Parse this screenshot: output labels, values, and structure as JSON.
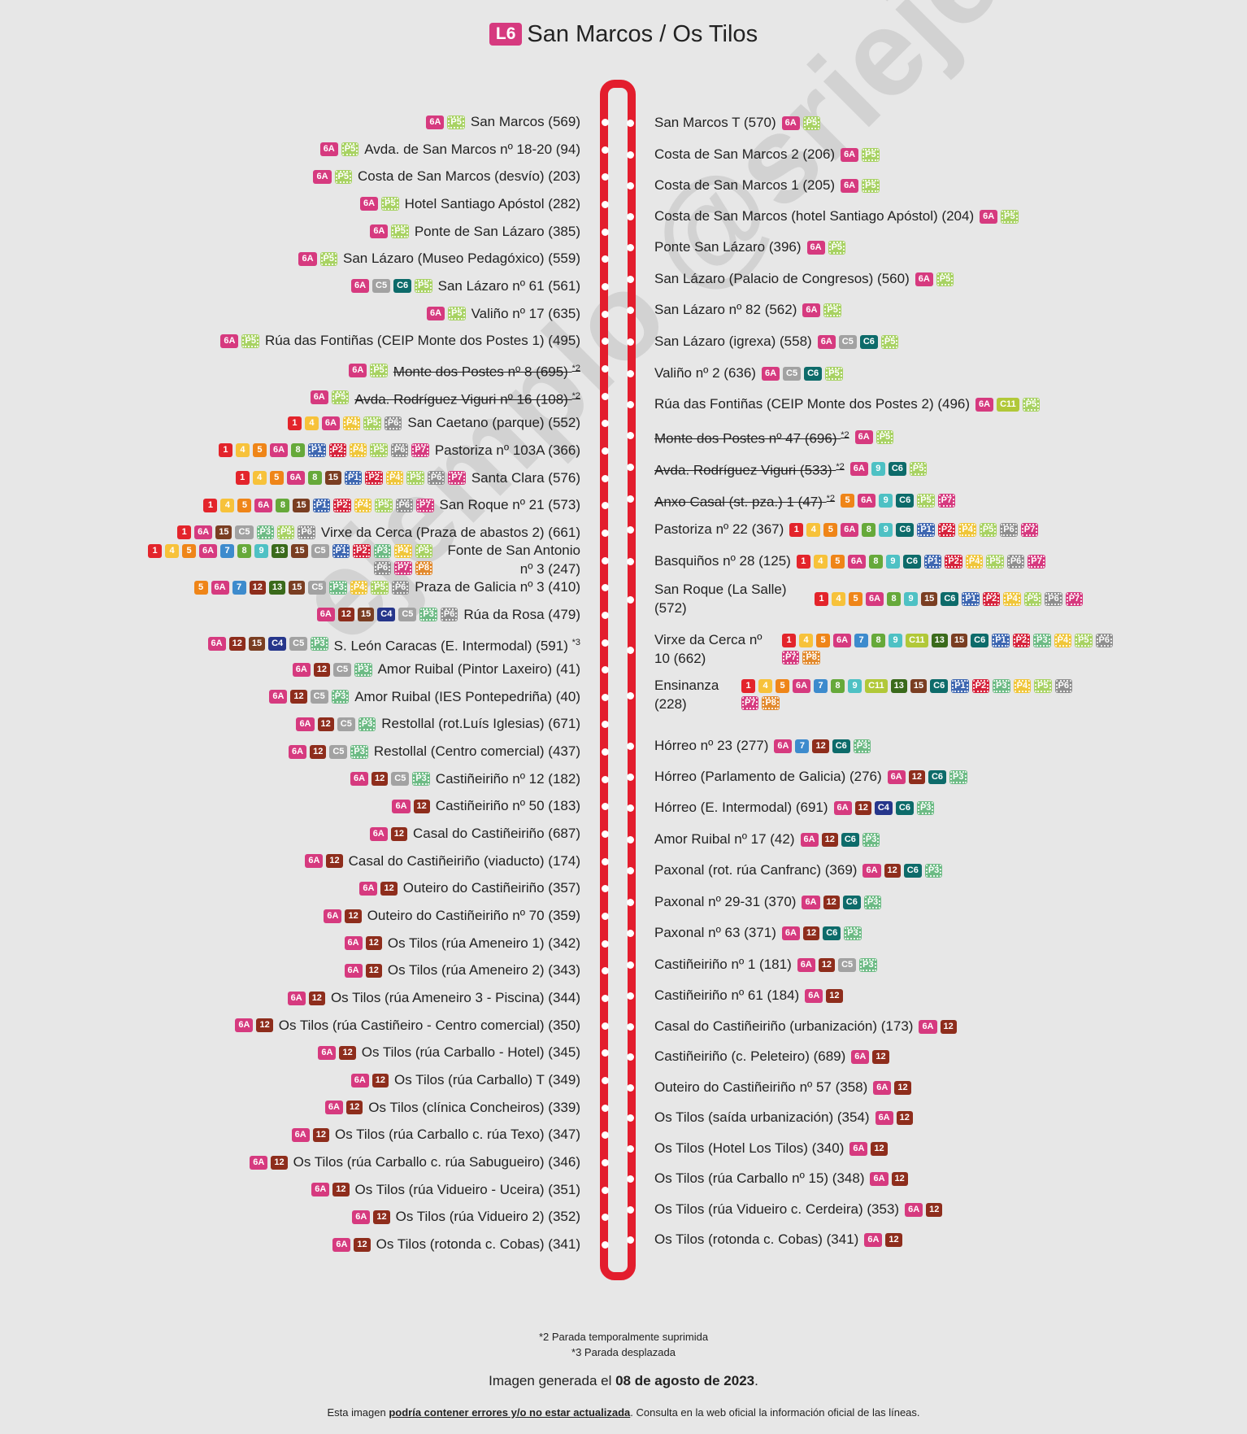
{
  "title": {
    "line": "L6",
    "name": "San Marcos / Os Tilos"
  },
  "colors": {
    "rail": "#e31d2d",
    "1": "#e3242b",
    "4": "#f7c23a",
    "5": "#ef8518",
    "6A": "#d63a7f",
    "7": "#3d8bcd",
    "8": "#66a93a",
    "9": "#4ec1c4",
    "12": "#8e2d1c",
    "13": "#3a6a1b",
    "15": "#7a3e22",
    "C4": "#26368b",
    "C5": "#a2a2a2",
    "C6": "#0d6b6a",
    "C11": "#b1c838",
    "P1": "#3e67b1",
    "P2": "#d6233c",
    "P3": "#6dbb85",
    "P4": "#f0c63a",
    "P5": "#a8d263",
    "P6": "#8f8f8f",
    "P7": "#d63a7f",
    "P8": "#e28a2e"
  },
  "left_stops": [
    {
      "name": "San Marcos (569)",
      "lines": [
        "6A",
        "P5"
      ]
    },
    {
      "name": "Avda. de San Marcos nº 18-20 (94)",
      "lines": [
        "6A",
        "P5"
      ]
    },
    {
      "name": "Costa de San Marcos (desvío) (203)",
      "lines": [
        "6A",
        "P5"
      ]
    },
    {
      "name": "Hotel Santiago Apóstol (282)",
      "lines": [
        "6A",
        "P5"
      ]
    },
    {
      "name": "Ponte de San Lázaro (385)",
      "lines": [
        "6A",
        "P5"
      ]
    },
    {
      "name": "San Lázaro (Museo Pedagóxico) (559)",
      "lines": [
        "6A",
        "P5"
      ]
    },
    {
      "name": "San Lázaro nº 61 (561)",
      "lines": [
        "6A",
        "C5",
        "C6",
        "P5"
      ]
    },
    {
      "name": "Valiño nº 17 (635)",
      "lines": [
        "6A",
        "P5"
      ]
    },
    {
      "name": "Rúa das Fontiñas (CEIP Monte dos Postes 1) (495)",
      "lines": [
        "6A",
        "P5"
      ]
    },
    {
      "name": "Monte dos Postes nº 8 (695)",
      "note": "*2",
      "strike": true,
      "lines": [
        "6A",
        "P5"
      ]
    },
    {
      "name": "Avda. Rodríguez Viguri nº 16 (108)",
      "note": "*2",
      "strike": true,
      "lines": [
        "6A",
        "P5"
      ]
    },
    {
      "name": "San Caetano (parque) (552)",
      "lines": [
        "1",
        "4",
        "6A",
        "P4",
        "P5",
        "P6"
      ]
    },
    {
      "name": "Pastoriza nº 103A (366)",
      "lines": [
        "1",
        "4",
        "5",
        "6A",
        "8",
        "P1",
        "P2",
        "P4",
        "P5",
        "P6",
        "P7"
      ]
    },
    {
      "name": "Santa Clara (576)",
      "lines": [
        "1",
        "4",
        "5",
        "6A",
        "8",
        "15",
        "P1",
        "P2",
        "P4",
        "P5",
        "P6",
        "P7"
      ]
    },
    {
      "name": "San Roque nº 21 (573)",
      "lines": [
        "1",
        "4",
        "5",
        "6A",
        "8",
        "15",
        "P1",
        "P2",
        "P4",
        "P5",
        "P6",
        "P7"
      ]
    },
    {
      "name": "Virxe da Cerca (Praza de abastos 2) (661)",
      "lines": [
        "1",
        "6A",
        "15",
        "C5",
        "P3",
        "P5",
        "P6"
      ]
    },
    {
      "name": "Fonte de San Antonio nº 3 (247)",
      "lines": [
        "1",
        "4",
        "5",
        "6A",
        "7",
        "8",
        "9",
        "13",
        "15",
        "C5",
        "P1",
        "P2",
        "P3",
        "P4",
        "P5",
        "P6",
        "P7",
        "P8"
      ],
      "wrap": true
    },
    {
      "name": "Praza de Galicia nº 3 (410)",
      "lines": [
        "5",
        "6A",
        "7",
        "12",
        "13",
        "15",
        "C5",
        "P3",
        "P4",
        "P5",
        "P6"
      ]
    },
    {
      "name": "Rúa da Rosa (479)",
      "lines": [
        "6A",
        "12",
        "15",
        "C4",
        "C5",
        "P3",
        "P6"
      ]
    },
    {
      "name": "S. León Caracas (E. Intermodal) (591)",
      "note": "*3",
      "lines": [
        "6A",
        "12",
        "15",
        "C4",
        "C5",
        "P3"
      ]
    },
    {
      "name": "Amor Ruibal (Pintor Laxeiro) (41)",
      "lines": [
        "6A",
        "12",
        "C5",
        "P3"
      ]
    },
    {
      "name": "Amor Ruibal (IES Pontepedriña) (40)",
      "lines": [
        "6A",
        "12",
        "C5",
        "P3"
      ]
    },
    {
      "name": "Restollal (rot.Luís Iglesias) (671)",
      "lines": [
        "6A",
        "12",
        "C5",
        "P3"
      ]
    },
    {
      "name": "Restollal (Centro comercial) (437)",
      "lines": [
        "6A",
        "12",
        "C5",
        "P3"
      ]
    },
    {
      "name": "Castiñeiriño nº 12 (182)",
      "lines": [
        "6A",
        "12",
        "C5",
        "P3"
      ]
    },
    {
      "name": "Castiñeiriño nº 50 (183)",
      "lines": [
        "6A",
        "12"
      ]
    },
    {
      "name": "Casal do Castiñeiriño (687)",
      "lines": [
        "6A",
        "12"
      ]
    },
    {
      "name": "Casal do Castiñeiriño (viaducto) (174)",
      "lines": [
        "6A",
        "12"
      ]
    },
    {
      "name": "Outeiro do Castiñeiriño (357)",
      "lines": [
        "6A",
        "12"
      ]
    },
    {
      "name": "Outeiro do Castiñeiriño nº 70 (359)",
      "lines": [
        "6A",
        "12"
      ]
    },
    {
      "name": "Os Tilos (rúa Ameneiro 1) (342)",
      "lines": [
        "6A",
        "12"
      ]
    },
    {
      "name": "Os Tilos (rúa Ameneiro 2) (343)",
      "lines": [
        "6A",
        "12"
      ]
    },
    {
      "name": "Os Tilos (rúa Ameneiro 3 - Piscina) (344)",
      "lines": [
        "6A",
        "12"
      ]
    },
    {
      "name": "Os Tilos (rúa Castiñeiro - Centro comercial) (350)",
      "lines": [
        "6A",
        "12"
      ]
    },
    {
      "name": "Os Tilos (rúa Carballo - Hotel) (345)",
      "lines": [
        "6A",
        "12"
      ]
    },
    {
      "name": "Os Tilos (rúa Carballo) T (349)",
      "lines": [
        "6A",
        "12"
      ]
    },
    {
      "name": "Os Tilos (clínica Concheiros) (339)",
      "lines": [
        "6A",
        "12"
      ]
    },
    {
      "name": "Os Tilos (rúa Carballo c. rúa Texo) (347)",
      "lines": [
        "6A",
        "12"
      ]
    },
    {
      "name": "Os Tilos (rúa Carballo c. rúa Sabugueiro) (346)",
      "lines": [
        "6A",
        "12"
      ]
    },
    {
      "name": "Os Tilos (rúa Vidueiro - Uceira) (351)",
      "lines": [
        "6A",
        "12"
      ]
    },
    {
      "name": "Os Tilos (rúa Vidueiro 2) (352)",
      "lines": [
        "6A",
        "12"
      ]
    },
    {
      "name": "Os Tilos (rotonda c. Cobas) (341)",
      "lines": [
        "6A",
        "12"
      ]
    }
  ],
  "right_stops": [
    {
      "name": "San Marcos T (570)",
      "lines": [
        "6A",
        "P5"
      ]
    },
    {
      "name": "Costa de San Marcos 2 (206)",
      "lines": [
        "6A",
        "P5"
      ]
    },
    {
      "name": "Costa de San Marcos 1 (205)",
      "lines": [
        "6A",
        "P5"
      ]
    },
    {
      "name": "Costa de San Marcos (hotel Santiago Apóstol) (204)",
      "lines": [
        "6A",
        "P5"
      ]
    },
    {
      "name": "Ponte San Lázaro (396)",
      "lines": [
        "6A",
        "P5"
      ]
    },
    {
      "name": "San Lázaro (Palacio de Congresos) (560)",
      "lines": [
        "6A",
        "P5"
      ]
    },
    {
      "name": "San Lázaro nº 82 (562)",
      "lines": [
        "6A",
        "P5"
      ]
    },
    {
      "name": "San Lázaro (igrexa) (558)",
      "lines": [
        "6A",
        "C5",
        "C6",
        "P5"
      ]
    },
    {
      "name": "Valiño nº 2 (636)",
      "lines": [
        "6A",
        "C5",
        "C6",
        "P5"
      ]
    },
    {
      "name": "Rúa das Fontiñas (CEIP Monte dos Postes 2) (496)",
      "lines": [
        "6A",
        "C11",
        "P5"
      ]
    },
    {
      "name": "Monte dos Postes nº 47 (696)",
      "note": "*2",
      "strike": true,
      "lines": [
        "6A",
        "P5"
      ]
    },
    {
      "name": "Avda. Rodríguez Viguri (533)",
      "note": "*2",
      "strike": true,
      "lines": [
        "6A",
        "9",
        "C6",
        "P5"
      ]
    },
    {
      "name": "Anxo Casal (st. pza.) 1 (47)",
      "note": "*2",
      "strike": true,
      "lines": [
        "5",
        "6A",
        "9",
        "C6",
        "P5",
        "P7"
      ]
    },
    {
      "name": "Pastoriza nº 22 (367)",
      "lines": [
        "1",
        "4",
        "5",
        "6A",
        "8",
        "9",
        "C6",
        "P1",
        "P2",
        "P4",
        "P5",
        "P6",
        "P7"
      ]
    },
    {
      "name": "Basquiños nº 28 (125)",
      "lines": [
        "1",
        "4",
        "5",
        "6A",
        "8",
        "9",
        "C6",
        "P1",
        "P2",
        "P4",
        "P5",
        "P6",
        "P7"
      ]
    },
    {
      "name": "San Roque (La Salle) (572)",
      "lines": [
        "1",
        "4",
        "5",
        "6A",
        "8",
        "9",
        "15",
        "C6",
        "P1",
        "P2",
        "P4",
        "P5",
        "P6",
        "P7"
      ],
      "wrap": true
    },
    {
      "name": "Virxe da Cerca nº 10 (662)",
      "lines": [
        "1",
        "4",
        "5",
        "6A",
        "7",
        "8",
        "9",
        "C11",
        "13",
        "15",
        "C6",
        "P1",
        "P2",
        "P3",
        "P4",
        "P5",
        "P6",
        "P7",
        "P8"
      ],
      "wrap": true
    },
    {
      "name": "Ensinanza (228)",
      "lines": [
        "1",
        "4",
        "5",
        "6A",
        "7",
        "8",
        "9",
        "C11",
        "13",
        "15",
        "C6",
        "P1",
        "P2",
        "P3",
        "P4",
        "P5",
        "P6",
        "P7",
        "P8"
      ],
      "wrap": true
    },
    {
      "name": "Hórreo nº 23 (277)",
      "lines": [
        "6A",
        "7",
        "12",
        "C6",
        "P3"
      ]
    },
    {
      "name": "Hórreo (Parlamento de Galicia) (276)",
      "lines": [
        "6A",
        "12",
        "C6",
        "P3"
      ]
    },
    {
      "name": "Hórreo (E. Intermodal) (691)",
      "lines": [
        "6A",
        "12",
        "C4",
        "C6",
        "P3"
      ]
    },
    {
      "name": "Amor Ruibal nº 17 (42)",
      "lines": [
        "6A",
        "12",
        "C6",
        "P3"
      ]
    },
    {
      "name": "Paxonal (rot. rúa Canfranc) (369)",
      "lines": [
        "6A",
        "12",
        "C6",
        "P3"
      ]
    },
    {
      "name": "Paxonal nº 29-31 (370)",
      "lines": [
        "6A",
        "12",
        "C6",
        "P3"
      ]
    },
    {
      "name": "Paxonal nº 63 (371)",
      "lines": [
        "6A",
        "12",
        "C6",
        "P3"
      ]
    },
    {
      "name": "Castiñeiriño nº 1 (181)",
      "lines": [
        "6A",
        "12",
        "C5",
        "P3"
      ]
    },
    {
      "name": "Castiñeiriño nº 61 (184)",
      "lines": [
        "6A",
        "12"
      ]
    },
    {
      "name": "Casal do Castiñeiriño (urbanización) (173)",
      "lines": [
        "6A",
        "12"
      ]
    },
    {
      "name": "Castiñeiriño (c. Peleteiro) (689)",
      "lines": [
        "6A",
        "12"
      ]
    },
    {
      "name": "Outeiro do Castiñeiriño nº 57 (358)",
      "lines": [
        "6A",
        "12"
      ]
    },
    {
      "name": "Os Tilos (saída urbanización) (354)",
      "lines": [
        "6A",
        "12"
      ]
    },
    {
      "name": "Os Tilos (Hotel Los Tilos) (340)",
      "lines": [
        "6A",
        "12"
      ]
    },
    {
      "name": "Os Tilos (rúa Carballo nº 15) (348)",
      "lines": [
        "6A",
        "12"
      ]
    },
    {
      "name": "Os Tilos (rúa Vidueiro c. Cerdeira) (353)",
      "lines": [
        "6A",
        "12"
      ]
    },
    {
      "name": "Os Tilos (rotonda c. Cobas) (341)",
      "lines": [
        "6A",
        "12"
      ]
    }
  ],
  "footnotes": [
    "*2 Parada temporalmente suprimida",
    "*3 Parada desplazada"
  ],
  "generated": {
    "prefix": "Imagen generada el ",
    "date": "08 de agosto de 2023",
    "suffix": "."
  },
  "disclaimer": {
    "prefix": "Esta imagen ",
    "bold": "podría contener errores y/o no estar actualizada",
    "suffix": ". Consulta en la web oficial la información oficial de las líneas."
  },
  "watermark": "ejemplo @sriejecaco"
}
